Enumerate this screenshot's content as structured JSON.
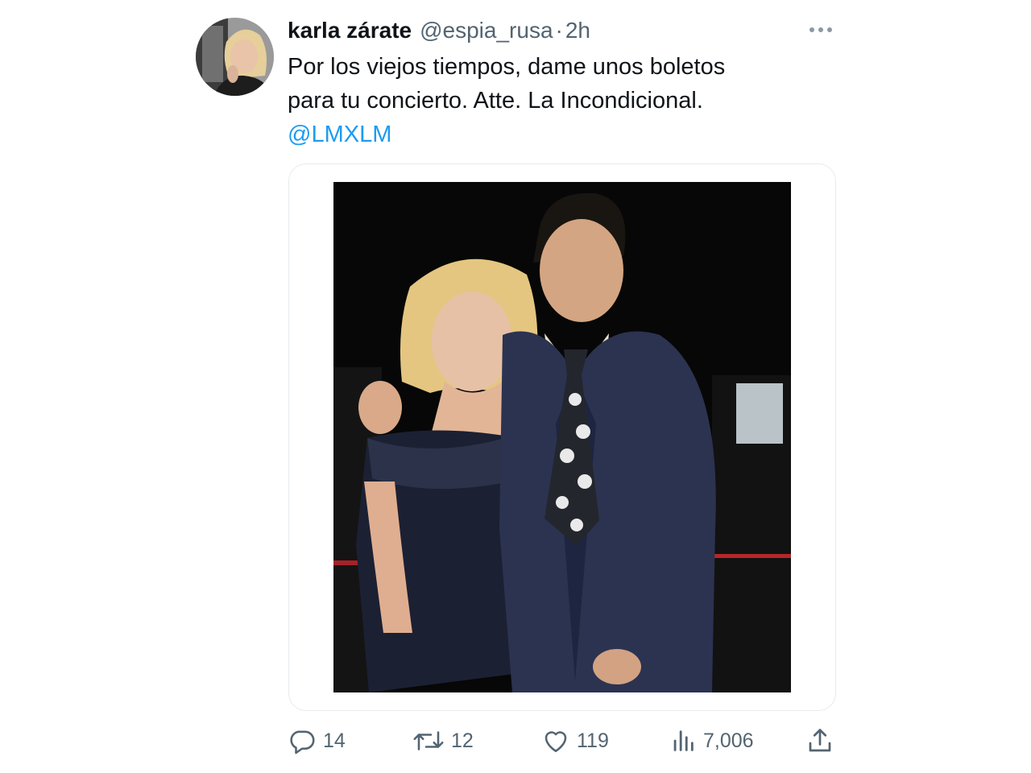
{
  "tweet": {
    "display_name": "karla zárate",
    "handle": "@espia_rusa",
    "separator": "·",
    "time": "2h",
    "text_line1": "Por los viejos tiempos, dame unos boletos",
    "text_line2": "para tu concierto. Atte. La Incondicional.",
    "mention": "@LMXLM",
    "more_icon": "more-horizontal-icon"
  },
  "actions": {
    "replies": "14",
    "retweets": "12",
    "likes": "119",
    "views": "7,006"
  },
  "icons": {
    "reply": "reply-icon",
    "retweet": "retweet-icon",
    "like": "heart-icon",
    "views": "views-icon",
    "share": "share-icon"
  },
  "colors": {
    "mention": "#1d9bf0",
    "secondary_text": "#536471",
    "primary_text": "#0f1419"
  }
}
